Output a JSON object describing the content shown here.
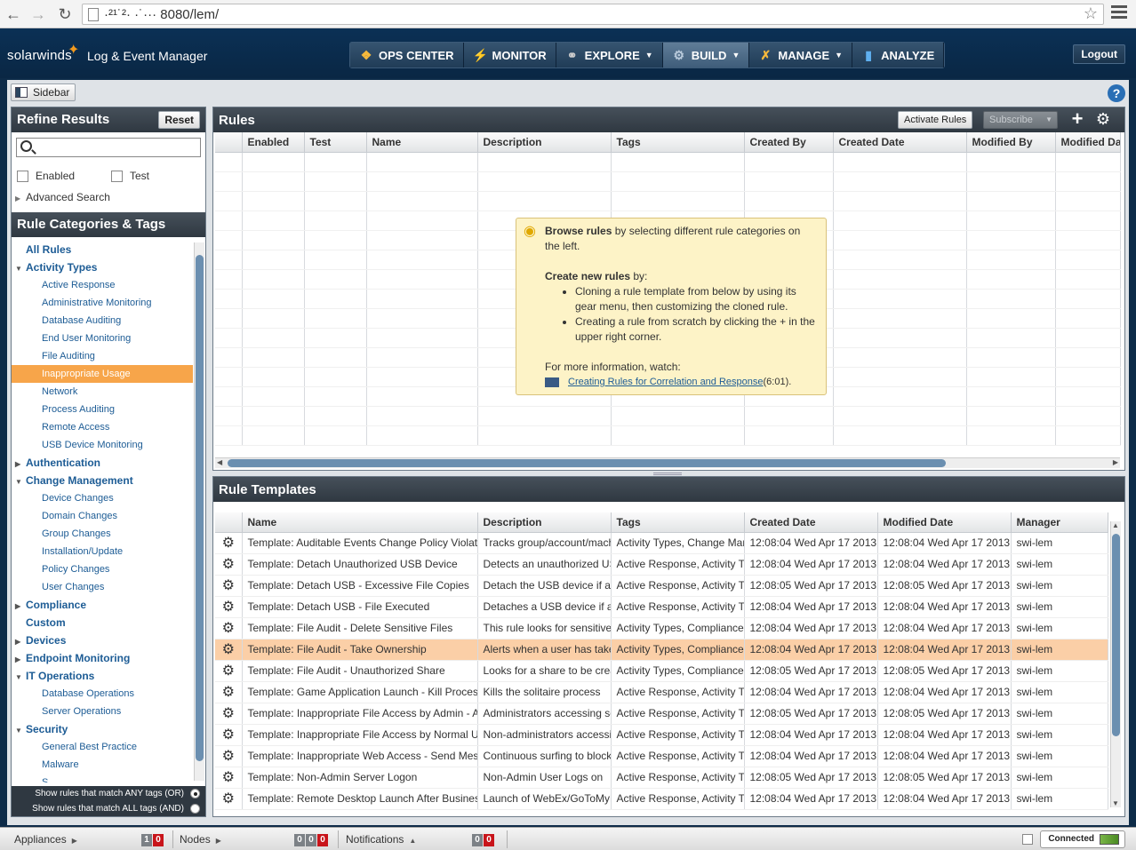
{
  "browser": {
    "url": "·²¹˙²· ·˙··· 8080/lem/"
  },
  "brand": {
    "logo": "solarwinds",
    "product": "Log & Event Manager"
  },
  "nav": {
    "items": [
      {
        "label": "OPS CENTER",
        "icon": "ops-center-icon"
      },
      {
        "label": "MONITOR",
        "icon": "lightning-icon"
      },
      {
        "label": "EXPLORE",
        "icon": "binoculars-icon"
      },
      {
        "label": "BUILD",
        "icon": "gear-icon"
      },
      {
        "label": "MANAGE",
        "icon": "wrench-icon"
      },
      {
        "label": "ANALYZE",
        "icon": "bar-chart-icon"
      }
    ],
    "logout": "Logout"
  },
  "toolbar": {
    "sidebar": "Sidebar"
  },
  "refine": {
    "title": "Refine Results",
    "reset": "Reset",
    "search_placeholder": "",
    "enabled": "Enabled",
    "test": "Test",
    "advanced": "Advanced Search"
  },
  "categories": {
    "title": "Rule Categories & Tags",
    "items": [
      {
        "label": "All Rules",
        "level": 0,
        "toggle": ""
      },
      {
        "label": "Activity Types",
        "level": 0,
        "toggle": "▼"
      },
      {
        "label": "Active Response",
        "level": 1
      },
      {
        "label": "Administrative Monitoring",
        "level": 1
      },
      {
        "label": "Database Auditing",
        "level": 1
      },
      {
        "label": "End User Monitoring",
        "level": 1
      },
      {
        "label": "File Auditing",
        "level": 1
      },
      {
        "label": "Inappropriate Usage",
        "level": 1,
        "selected": true
      },
      {
        "label": "Network",
        "level": 1
      },
      {
        "label": "Process Auditing",
        "level": 1
      },
      {
        "label": "Remote Access",
        "level": 1
      },
      {
        "label": "USB Device Monitoring",
        "level": 1
      },
      {
        "label": "Authentication",
        "level": 0,
        "toggle": "▶"
      },
      {
        "label": "Change Management",
        "level": 0,
        "toggle": "▼"
      },
      {
        "label": "Device Changes",
        "level": 1
      },
      {
        "label": "Domain Changes",
        "level": 1
      },
      {
        "label": "Group Changes",
        "level": 1
      },
      {
        "label": "Installation/Update",
        "level": 1
      },
      {
        "label": "Policy Changes",
        "level": 1
      },
      {
        "label": "User Changes",
        "level": 1
      },
      {
        "label": "Compliance",
        "level": 0,
        "toggle": "▶"
      },
      {
        "label": "Custom",
        "level": 0,
        "toggle": ""
      },
      {
        "label": "Devices",
        "level": 0,
        "toggle": "▶"
      },
      {
        "label": "Endpoint Monitoring",
        "level": 0,
        "toggle": "▶"
      },
      {
        "label": "IT Operations",
        "level": 0,
        "toggle": "▼"
      },
      {
        "label": "Database Operations",
        "level": 1
      },
      {
        "label": "Server Operations",
        "level": 1
      },
      {
        "label": "Security",
        "level": 0,
        "toggle": "▼"
      },
      {
        "label": "General Best Practice",
        "level": 1
      },
      {
        "label": "Malware",
        "level": 1
      },
      {
        "label": "S",
        "level": 1
      }
    ],
    "match_any": "Show rules that match ANY tags (OR)",
    "match_all": "Show rules that match ALL tags (AND)"
  },
  "rules": {
    "title": "Rules",
    "activate": "Activate Rules",
    "subscribe": "Subscribe",
    "columns": [
      "",
      "Enabled",
      "Test",
      "Name",
      "Description",
      "Tags",
      "Created By",
      "Created Date",
      "Modified By",
      "Modified Date"
    ],
    "empty_rows": 15,
    "tip": {
      "browse_bold": "Browse rules",
      "browse_rest": " by selecting different rule categories on the left.",
      "create_bold": "Create new rules",
      "create_rest": " by:",
      "bullet1": "Cloning a rule template from below by using its gear menu, then customizing the cloned rule.",
      "bullet2": "Creating a rule from scratch by clicking the + in the upper right corner.",
      "more": "For more information, watch:",
      "link": "Creating Rules for Correlation and Response",
      "duration": " (6:01)."
    }
  },
  "templates": {
    "title": "Rule Templates",
    "columns": [
      "",
      "Name",
      "Description",
      "Tags",
      "Created Date",
      "Modified Date",
      "Manager"
    ],
    "rows": [
      {
        "name": "Template: Auditable Events Change Policy Violation",
        "description": "Tracks group/account/machine",
        "tags": "Activity Types, Change Management",
        "created": "12:08:04 Wed Apr 17 2013",
        "modified": "12:08:04 Wed Apr 17 2013",
        "manager": "swi-lem"
      },
      {
        "name": "Template: Detach Unauthorized USB Device",
        "description": "Detects an unauthorized USB",
        "tags": "Active Response, Activity Types",
        "created": "12:08:04 Wed Apr 17 2013",
        "modified": "12:08:04 Wed Apr 17 2013",
        "manager": "swi-lem"
      },
      {
        "name": "Template: Detach USB - Excessive File Copies",
        "description": "Detach the USB device if a",
        "tags": "Active Response, Activity Types",
        "created": "12:08:05 Wed Apr 17 2013",
        "modified": "12:08:05 Wed Apr 17 2013",
        "manager": "swi-lem"
      },
      {
        "name": "Template: Detach USB - File Executed",
        "description": "Detaches a USB device if a",
        "tags": "Active Response, Activity Types",
        "created": "12:08:04 Wed Apr 17 2013",
        "modified": "12:08:04 Wed Apr 17 2013",
        "manager": "swi-lem"
      },
      {
        "name": "Template: File Audit - Delete Sensitive Files",
        "description": "This rule looks for sensitive",
        "tags": "Activity Types, Compliance",
        "created": "12:08:04 Wed Apr 17 2013",
        "modified": "12:08:04 Wed Apr 17 2013",
        "manager": "swi-lem"
      },
      {
        "name": "Template: File Audit - Take Ownership",
        "description": "Alerts when a user has taken",
        "tags": "Activity Types, Compliance",
        "created": "12:08:04 Wed Apr 17 2013",
        "modified": "12:08:04 Wed Apr 17 2013",
        "manager": "swi-lem",
        "selected": true
      },
      {
        "name": "Template: File Audit - Unauthorized Share",
        "description": "Looks for a share to be created",
        "tags": "Activity Types, Compliance",
        "created": "12:08:05 Wed Apr 17 2013",
        "modified": "12:08:05 Wed Apr 17 2013",
        "manager": "swi-lem"
      },
      {
        "name": "Template: Game Application Launch - Kill Process",
        "description": "Kills the solitaire process",
        "tags": "Active Response, Activity Types",
        "created": "12:08:04 Wed Apr 17 2013",
        "modified": "12:08:04 Wed Apr 17 2013",
        "manager": "swi-lem"
      },
      {
        "name": "Template: Inappropriate File Access by Admin - Alert",
        "description": "Administrators accessing sensitive",
        "tags": "Active Response, Activity Types",
        "created": "12:08:05 Wed Apr 17 2013",
        "modified": "12:08:05 Wed Apr 17 2013",
        "manager": "swi-lem"
      },
      {
        "name": "Template: Inappropriate File Access by Normal User",
        "description": "Non-administrators accessing",
        "tags": "Active Response, Activity Types",
        "created": "12:08:04 Wed Apr 17 2013",
        "modified": "12:08:04 Wed Apr 17 2013",
        "manager": "swi-lem"
      },
      {
        "name": "Template: Inappropriate Web Access - Send Message",
        "description": "Continuous surfing to blocked",
        "tags": "Active Response, Activity Types",
        "created": "12:08:04 Wed Apr 17 2013",
        "modified": "12:08:04 Wed Apr 17 2013",
        "manager": "swi-lem"
      },
      {
        "name": "Template: Non-Admin Server Logon",
        "description": "Non-Admin User Logs on",
        "tags": "Active Response, Activity Types",
        "created": "12:08:05 Wed Apr 17 2013",
        "modified": "12:08:05 Wed Apr 17 2013",
        "manager": "swi-lem"
      },
      {
        "name": "Template: Remote Desktop Launch After Business Hours",
        "description": "Launch of WebEx/GoToMyPC",
        "tags": "Active Response, Activity Types",
        "created": "12:08:04 Wed Apr 17 2013",
        "modified": "12:08:04 Wed Apr 17 2013",
        "manager": "swi-lem"
      }
    ]
  },
  "status": {
    "appliances": "Appliances",
    "appliances_counts": [
      "1",
      "0"
    ],
    "nodes": "Nodes",
    "nodes_counts": [
      "0",
      "0",
      "0"
    ],
    "notifications": "Notifications",
    "notifications_counts": [
      "0",
      "0"
    ],
    "connected": "Connected"
  }
}
